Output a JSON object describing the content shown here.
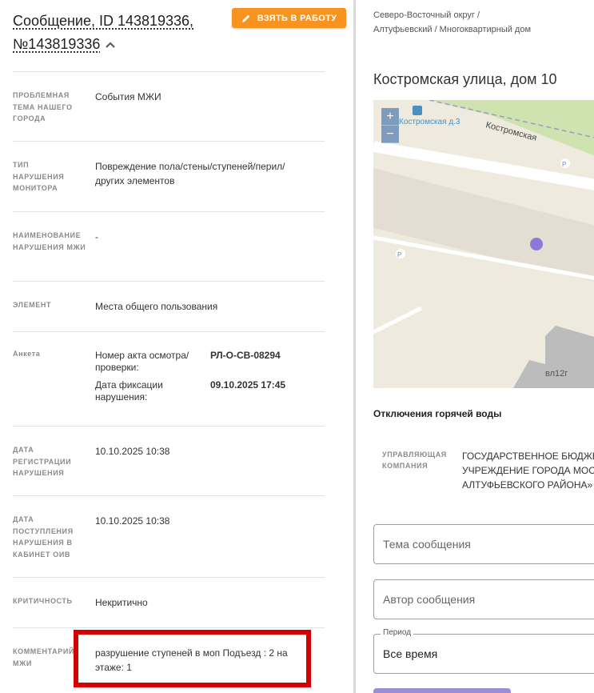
{
  "message": {
    "title_line1": "Сообщение, ID 143819336,",
    "title_line2": "№143819336",
    "take_button": "ВЗЯТЬ В РАБОТУ"
  },
  "fields": [
    {
      "label": "ПРОБЛЕМНАЯ ТЕМА НАШЕГО ГОРОДА",
      "value": "События МЖИ"
    },
    {
      "label": "ТИП НАРУШЕНИЯ МОНИТОРА",
      "value": "Повреждение пола/стены/ступеней/перил/других элементов"
    },
    {
      "label": "НАИМЕНОВАНИЕ НАРУШЕНИЯ МЖИ",
      "value": "-"
    },
    {
      "label": "ЭЛЕМЕНТ",
      "value": "Места общего пользования"
    },
    {
      "label": "Анкета",
      "value": ""
    },
    {
      "label": "ДАТА РЕГИСТРАЦИИ НАРУШЕНИЯ",
      "value": "10.10.2025 10:38"
    },
    {
      "label": "ДАТА ПОСТУПЛЕНИЯ НАРУШЕНИЯ В КАБИНЕТ ОИВ",
      "value": "10.10.2025 10:38"
    },
    {
      "label": "КРИТИЧНОСТЬ",
      "value": "Некритично"
    },
    {
      "label": "КОММЕНТАРИЙ МЖИ",
      "value": "разрушение ступеней в моп Подъезд : 2 на этаже: 1"
    }
  ],
  "anketa": [
    {
      "key": "Номер акта осмотра/проверки:",
      "value": "РЛ-О-СВ-08294"
    },
    {
      "key": "Дата фиксации нарушения:",
      "value": "09.10.2025 17:45"
    }
  ],
  "location": {
    "breadcrumb": "Северо-Восточный округ / Алтуфьевский / Многоквартирный дом",
    "address": "Костромская улица, дом 10",
    "map": {
      "street_label": "Костромская",
      "stop_label": "Костромская д.3",
      "building_label": "вл12г",
      "zoom_in": "+",
      "zoom_out": "−",
      "parking_label": "P"
    },
    "hot_water": "Отключения горячей воды",
    "management_label": "УПРАВЛЯЮЩАЯ КОМПАНИЯ",
    "management_lines": [
      "ГОСУДАРСТВЕННОЕ БЮДЖЕТНОЕ",
      "УЧРЕЖДЕНИЕ ГОРОДА МОСКВЫ",
      "АЛТУФЬЕВСКОГО РАЙОНА»"
    ]
  },
  "filters": {
    "topic_placeholder": "Тема сообщения",
    "author_placeholder": "Автор сообщения",
    "period_label": "Период",
    "period_value": "Все время"
  },
  "colors": {
    "accent_orange": "#f7931e",
    "highlight_red": "#d50000",
    "marker_purple": "#8f78d8"
  }
}
